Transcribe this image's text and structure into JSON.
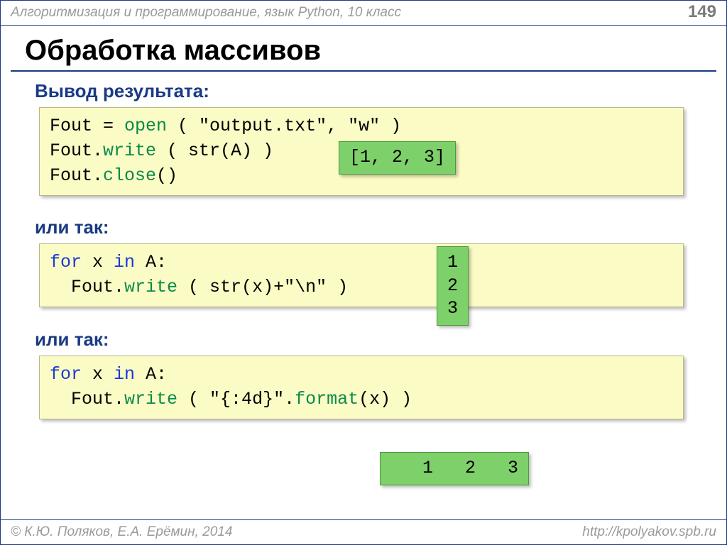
{
  "header": {
    "breadcrumb": "Алгоритмизация и программирование, язык Python, 10 класс",
    "page_number": "149"
  },
  "title": "Обработка массивов",
  "section1": {
    "heading": "Вывод результата:",
    "code_line1_a": "Fout = ",
    "code_line1_b": "open",
    "code_line1_c": " ( \"output.txt\", \"w\" )",
    "code_line2_a": "Fout.",
    "code_line2_b": "write",
    "code_line2_c": " ( str(A) )",
    "code_line3_a": "Fout.",
    "code_line3_b": "close",
    "code_line3_c": "()",
    "output": "[1, 2, 3]"
  },
  "section2": {
    "heading": "или так:",
    "code_line1_a": "for",
    "code_line1_b": " x ",
    "code_line1_c": "in",
    "code_line1_d": " A:",
    "code_line2_a": "  Fout.",
    "code_line2_b": "write",
    "code_line2_c": " ( str(x)+\"\\n\" )",
    "output": "1\n2\n3"
  },
  "section3": {
    "heading": "или так:",
    "code_line1_a": "for",
    "code_line1_b": " x ",
    "code_line1_c": "in",
    "code_line1_d": " A:",
    "code_line2_a": "  Fout.",
    "code_line2_b": "write",
    "code_line2_c": " ( \"{:4d}\".",
    "code_line2_d": "format",
    "code_line2_e": "(x) )",
    "output": "   1   2   3"
  },
  "footer": {
    "copyright": "© К.Ю. Поляков, Е.А. Ерёмин, 2014",
    "url": "http://kpolyakov.spb.ru"
  }
}
